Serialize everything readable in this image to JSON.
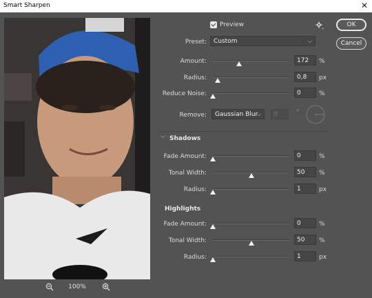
{
  "window": {
    "title": "Smart Sharpen",
    "close_glyph": "✕"
  },
  "preview": {
    "label": "Preview",
    "checked": true,
    "zoom_level": "100%"
  },
  "buttons": {
    "ok": "OK",
    "cancel": "Cancel"
  },
  "preset": {
    "label": "Preset:",
    "value": "Custom"
  },
  "main": {
    "amount": {
      "label": "Amount:",
      "value": "172",
      "unit": "%",
      "level": 0.34
    },
    "radius": {
      "label": "Radius:",
      "value": "0,8",
      "unit": "px",
      "level": 0.06
    },
    "reduce_noise": {
      "label": "Reduce Noise:",
      "value": "0",
      "unit": "%",
      "level": 0.0
    },
    "remove": {
      "label": "Remove:",
      "value": "Gaussian Blur",
      "angle_value": "0",
      "angle_unit": "°"
    }
  },
  "shadows": {
    "title": "Shadows",
    "fade_amount": {
      "label": "Fade Amount:",
      "value": "0",
      "unit": "%",
      "level": 0.0
    },
    "tonal_width": {
      "label": "Tonal Width:",
      "value": "50",
      "unit": "%",
      "level": 0.5
    },
    "radius": {
      "label": "Radius:",
      "value": "1",
      "unit": "px",
      "level": 0.0
    }
  },
  "highlights": {
    "title": "Highlights",
    "fade_amount": {
      "label": "Fade Amount:",
      "value": "0",
      "unit": "%",
      "level": 0.0
    },
    "tonal_width": {
      "label": "Tonal Width:",
      "value": "50",
      "unit": "%",
      "level": 0.5
    },
    "radius": {
      "label": "Radius:",
      "value": "1",
      "unit": "px",
      "level": 0.0
    }
  },
  "icons": {
    "gear": "gear-icon",
    "zoom_in": "zoom-in-icon",
    "zoom_out": "zoom-out-icon",
    "section_chevron": "chevron-down-icon",
    "angle_dial": "angle-dial-icon"
  }
}
